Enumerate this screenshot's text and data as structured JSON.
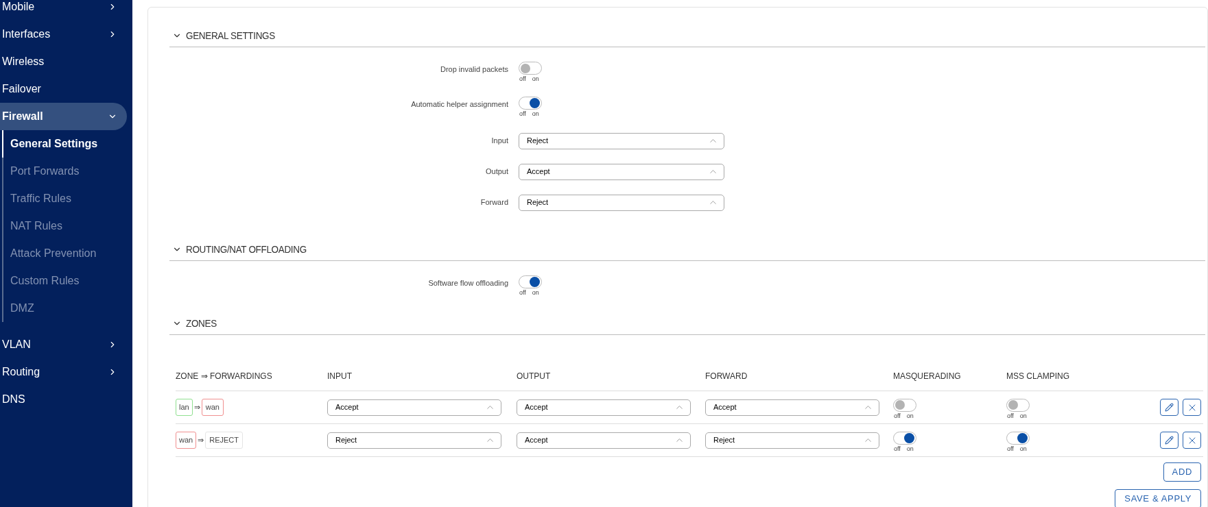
{
  "sidebar": {
    "items": [
      {
        "label": "Mobile",
        "kind": "group",
        "expanded": false,
        "selected": false
      },
      {
        "label": "Interfaces",
        "kind": "group",
        "expanded": false,
        "selected": false
      },
      {
        "label": "Wireless",
        "kind": "link",
        "selected": false
      },
      {
        "label": "Failover",
        "kind": "link",
        "selected": false
      },
      {
        "label": "Firewall",
        "kind": "group",
        "expanded": true,
        "selected": true,
        "children": [
          {
            "label": "General Settings",
            "selected": true
          },
          {
            "label": "Port Forwards",
            "selected": false
          },
          {
            "label": "Traffic Rules",
            "selected": false
          },
          {
            "label": "NAT Rules",
            "selected": false
          },
          {
            "label": "Attack Prevention",
            "selected": false
          },
          {
            "label": "Custom Rules",
            "selected": false
          },
          {
            "label": "DMZ",
            "selected": false
          }
        ]
      },
      {
        "label": "VLAN",
        "kind": "group",
        "expanded": false,
        "selected": false
      },
      {
        "label": "Routing",
        "kind": "group",
        "expanded": false,
        "selected": false
      },
      {
        "label": "DNS",
        "kind": "link",
        "selected": false
      }
    ]
  },
  "sections": [
    {
      "title": "GENERAL SETTINGS",
      "expanded": true,
      "fields": [
        {
          "kind": "toggle",
          "label": "Drop invalid packets",
          "on": false,
          "off_label": "off",
          "on_label": "on"
        },
        {
          "kind": "toggle",
          "label": "Automatic helper assignment",
          "on": true,
          "off_label": "off",
          "on_label": "on"
        },
        {
          "kind": "select",
          "label": "Input",
          "value": "Reject"
        },
        {
          "kind": "select",
          "label": "Output",
          "value": "Accept"
        },
        {
          "kind": "select",
          "label": "Forward",
          "value": "Reject"
        }
      ]
    },
    {
      "title": "ROUTING/NAT OFFLOADING",
      "expanded": true,
      "fields": [
        {
          "kind": "toggle",
          "label": "Software flow offloading",
          "on": true,
          "off_label": "off",
          "on_label": "on"
        }
      ]
    },
    {
      "title": "ZONES",
      "expanded": true
    }
  ],
  "zones_table": {
    "columns": [
      "ZONE ⇒ FORWARDINGS",
      "INPUT",
      "OUTPUT",
      "FORWARD",
      "MASQUERADING",
      "MSS CLAMPING"
    ],
    "rows": [
      {
        "zone": {
          "label": "lan",
          "color": "#90e090"
        },
        "arrow": "⇒",
        "target": {
          "label": "wan",
          "color": "#f09090"
        },
        "input": "Accept",
        "output": "Accept",
        "forward": "Accept",
        "masquerading": {
          "on": false,
          "off_label": "off",
          "on_label": "on"
        },
        "mss_clamping": {
          "on": false,
          "off_label": "off",
          "on_label": "on"
        }
      },
      {
        "zone": {
          "label": "wan",
          "color": "#f09090"
        },
        "arrow": "⇒",
        "target": {
          "label": "REJECT",
          "color": "#e5e5e5"
        },
        "input": "Reject",
        "output": "Accept",
        "forward": "Reject",
        "masquerading": {
          "on": true,
          "off_label": "off",
          "on_label": "on"
        },
        "mss_clamping": {
          "on": true,
          "off_label": "off",
          "on_label": "on"
        }
      }
    ],
    "add_button": "ADD"
  },
  "save_button": "SAVE & APPLY"
}
